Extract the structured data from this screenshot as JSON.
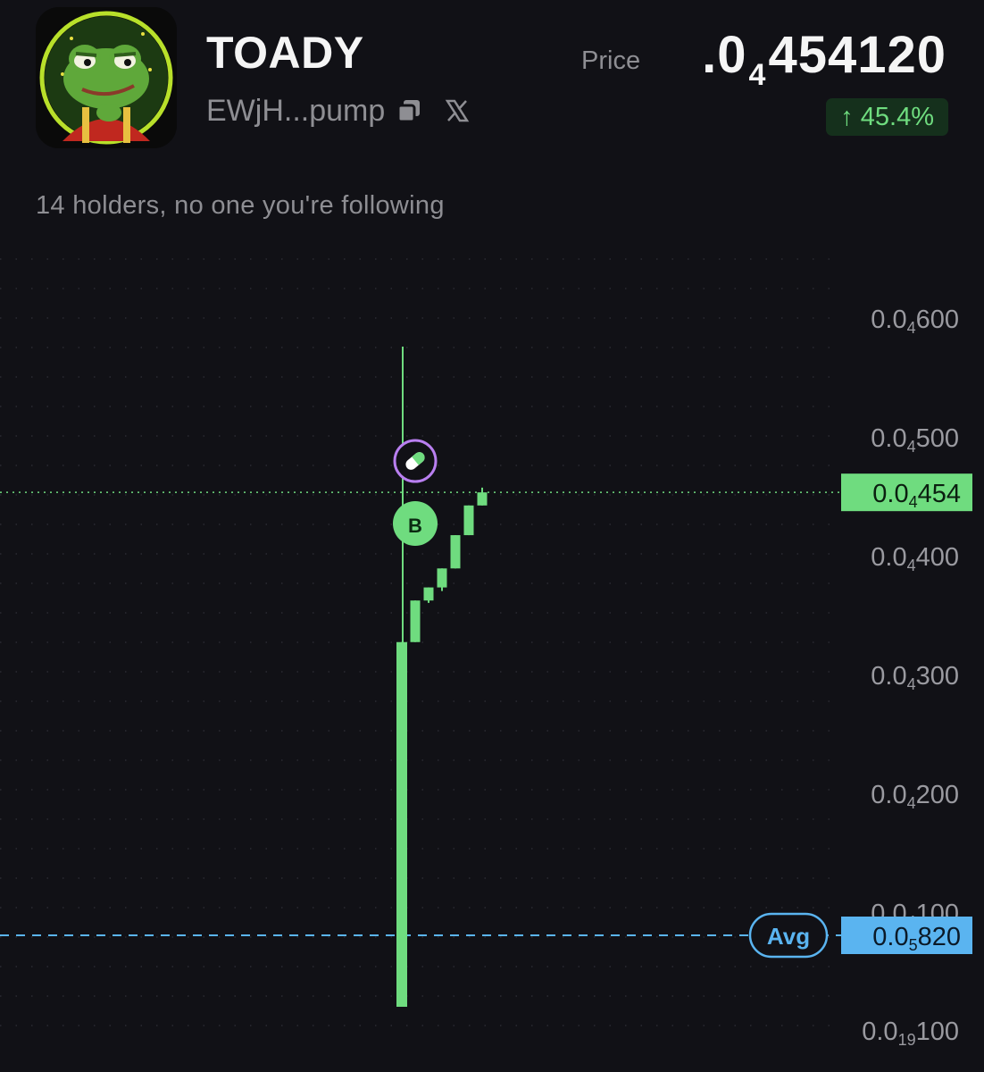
{
  "token": {
    "name": "TOADY",
    "address": "EWjH...pump",
    "holders_text": "14 holders, no one you're following"
  },
  "icons": {
    "avatar": "frog-avatar-icon",
    "copy": "copy-icon",
    "x": "x-social-icon",
    "buy_marker": "buy-marker-icon",
    "pill": "pill-icon"
  },
  "price": {
    "label": "Price",
    "prefix": ".0",
    "zeros_sub": "4",
    "digits": "454120",
    "change": "↑ 45.4%"
  },
  "colors": {
    "accent_green": "#6fdc7f",
    "avg_blue": "#5ab4f0",
    "pill_purple": "#b97ff0",
    "background": "#111116"
  },
  "chart_data": {
    "type": "candlestick",
    "y_tick_labels": [
      {
        "main": "0.0",
        "sub": "4",
        "rest": "600",
        "value": 6e-05
      },
      {
        "main": "0.0",
        "sub": "4",
        "rest": "500",
        "value": 5e-05
      },
      {
        "main": "0.0",
        "sub": "4",
        "rest": "400",
        "value": 4e-05
      },
      {
        "main": "0.0",
        "sub": "4",
        "rest": "300",
        "value": 3e-05
      },
      {
        "main": "0.0",
        "sub": "4",
        "rest": "200",
        "value": 2e-05
      },
      {
        "main": "0.0",
        "sub": "4",
        "rest": "100",
        "value": 1e-05
      },
      {
        "main": "0.0",
        "sub": "19",
        "rest": "100",
        "value": 0.0
      }
    ],
    "current_price_tag": {
      "main": "0.0",
      "sub": "4",
      "rest": "454",
      "value": 4.54e-05
    },
    "avg_tag": {
      "label": "Avg",
      "main": "0.0",
      "sub": "5",
      "rest": "820",
      "value": 8.2e-06
    },
    "buy_marker_label": "B",
    "candles": [
      {
        "open": 2e-06,
        "close": 3.28e-05,
        "high": 3.28e-05,
        "low": 2e-06
      },
      {
        "open": 3.28e-05,
        "close": 3.63e-05,
        "high": 3.63e-05,
        "low": 3.28e-05
      },
      {
        "open": 3.63e-05,
        "close": 3.74e-05,
        "high": 3.74e-05,
        "low": 3.61e-05
      },
      {
        "open": 3.74e-05,
        "close": 3.9e-05,
        "high": 3.9e-05,
        "low": 3.71e-05
      },
      {
        "open": 3.9e-05,
        "close": 4.18e-05,
        "high": 4.18e-05,
        "low": 3.9e-05
      },
      {
        "open": 4.18e-05,
        "close": 4.43e-05,
        "high": 4.43e-05,
        "low": 4.18e-05
      },
      {
        "open": 4.43e-05,
        "close": 4.54e-05,
        "high": 4.58e-05,
        "low": 4.43e-05
      }
    ],
    "grid": true
  }
}
